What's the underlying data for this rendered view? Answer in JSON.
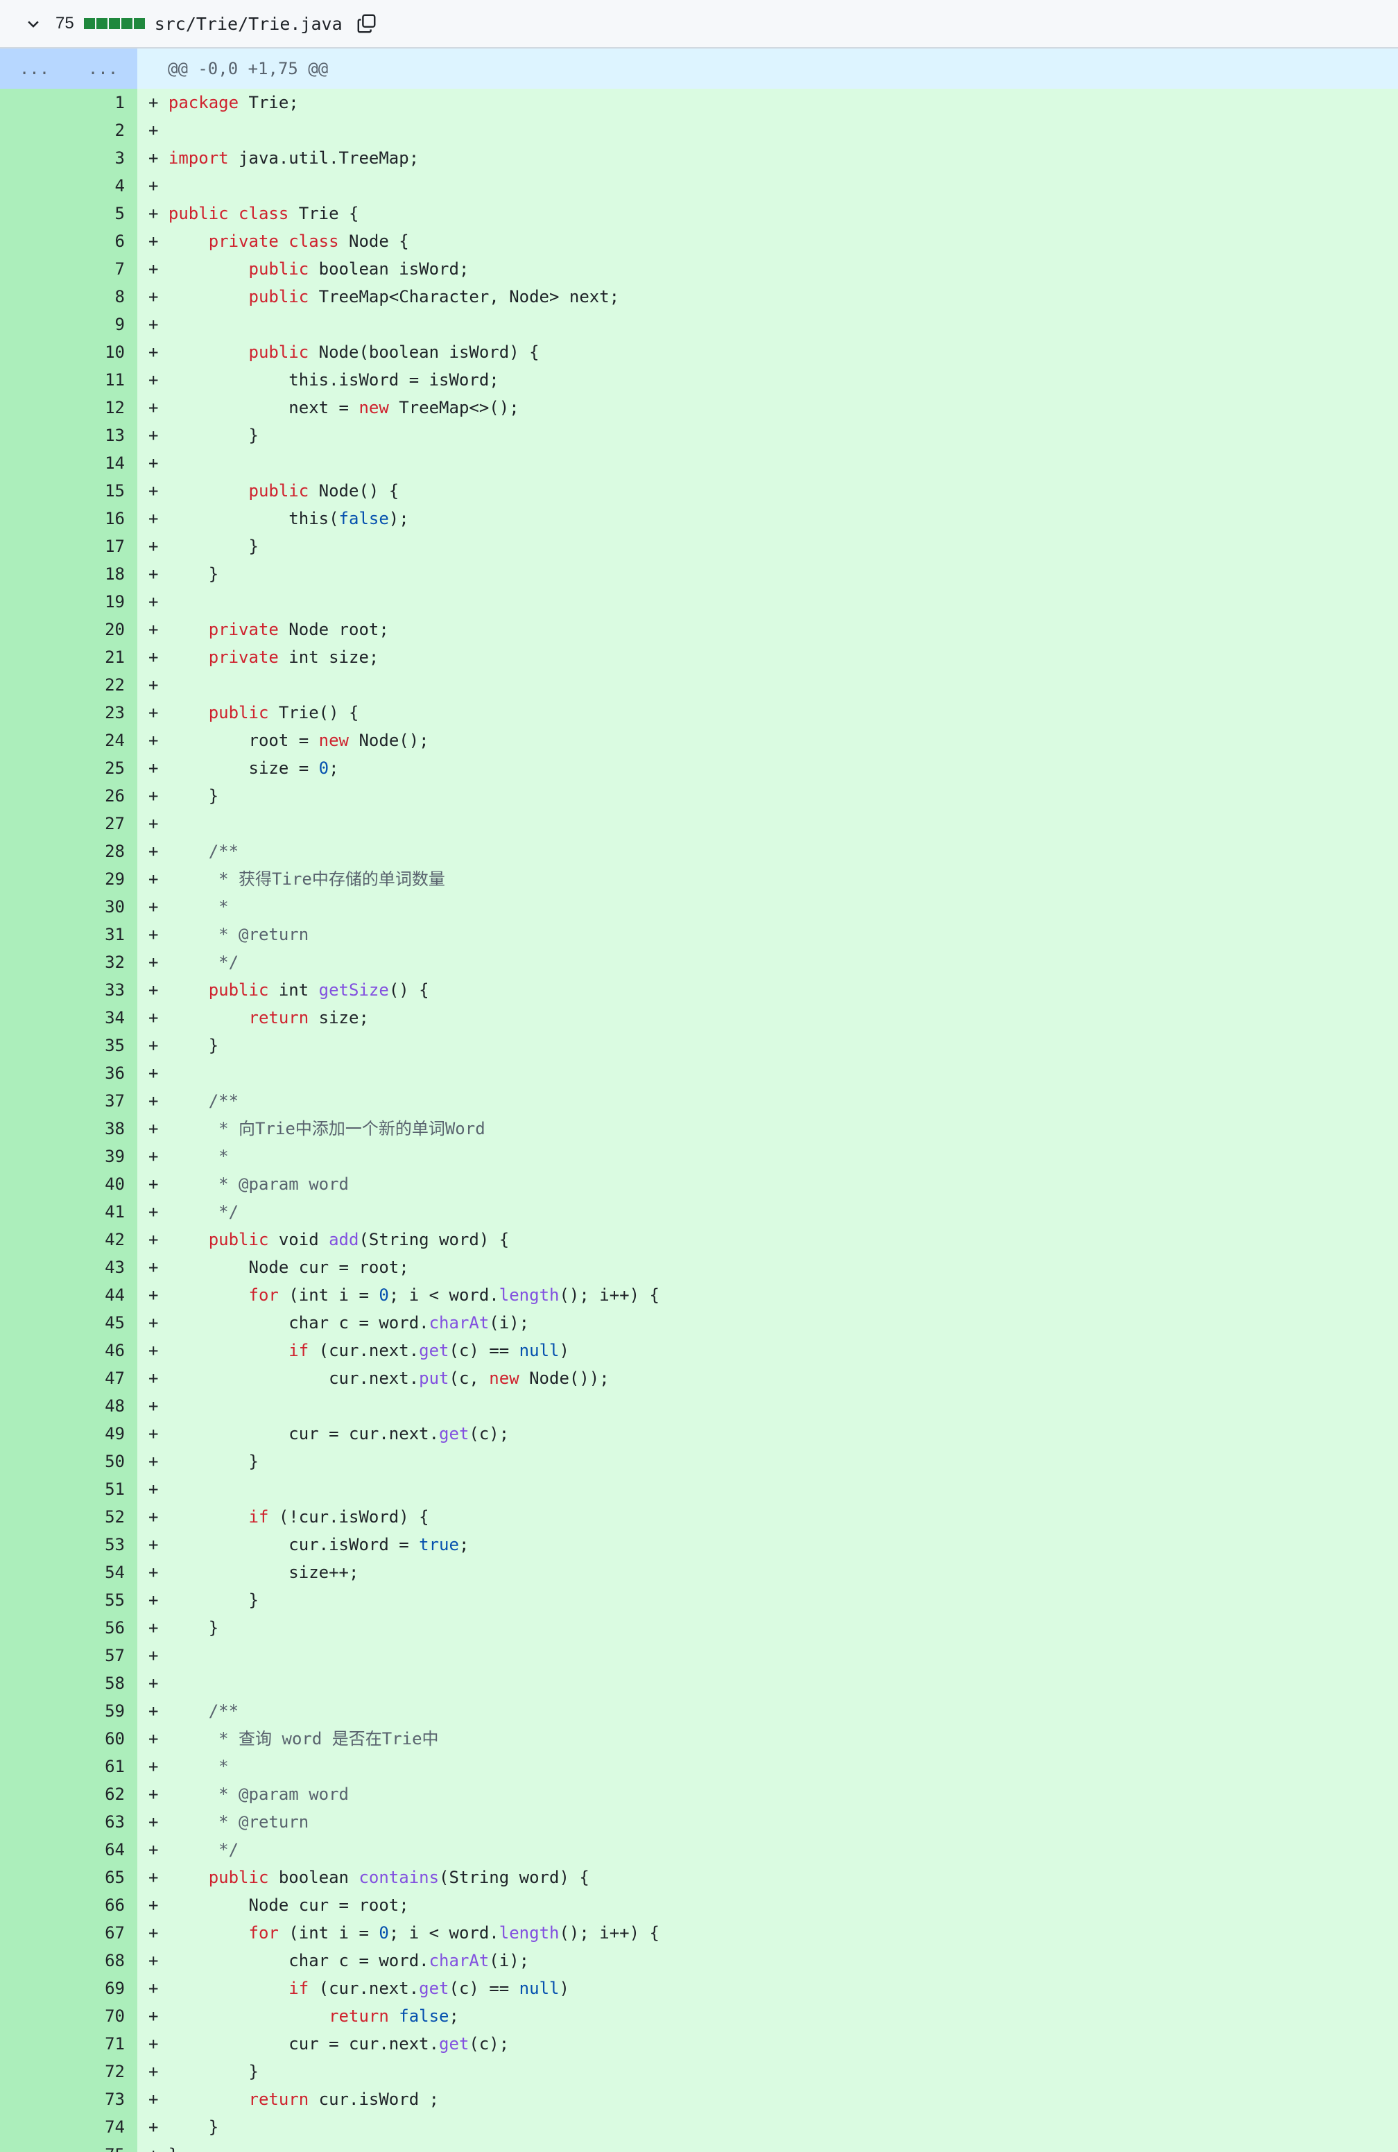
{
  "file_header": {
    "icon_toggle": "chevron-down-icon",
    "changes": "75",
    "path": "src/Trie/Trie.java",
    "icon_copy": "copy-icon"
  },
  "hunk": {
    "old_expand": "...",
    "new_expand": "...",
    "header": "@@ -0,0 +1,75 @@"
  },
  "colors": {
    "addition_gutter": "#aceebb",
    "addition_bg": "#dafbe1",
    "hunk_gutter": "#b7d7ff",
    "hunk_bg": "#ddf4ff",
    "keyword": "#cf222e",
    "function": "#8250df",
    "literal": "#0550ae",
    "comment": "#59636e",
    "diffstat": "#1f883d"
  },
  "lines": [
    {
      "n": "1",
      "code": [
        [
          "kw",
          "package"
        ],
        [
          "t",
          " Trie;"
        ]
      ]
    },
    {
      "n": "2",
      "code": []
    },
    {
      "n": "3",
      "code": [
        [
          "kw",
          "import"
        ],
        [
          "t",
          " java.util.TreeMap;"
        ]
      ]
    },
    {
      "n": "4",
      "code": []
    },
    {
      "n": "5",
      "code": [
        [
          "kw",
          "public class"
        ],
        [
          "t",
          " Trie {"
        ]
      ]
    },
    {
      "n": "6",
      "code": [
        [
          "t",
          "    "
        ],
        [
          "kw",
          "private class"
        ],
        [
          "t",
          " Node {"
        ]
      ]
    },
    {
      "n": "7",
      "code": [
        [
          "t",
          "        "
        ],
        [
          "kw",
          "public"
        ],
        [
          "t",
          " boolean isWord;"
        ]
      ]
    },
    {
      "n": "8",
      "code": [
        [
          "t",
          "        "
        ],
        [
          "kw",
          "public"
        ],
        [
          "t",
          " TreeMap<Character, Node> next;"
        ]
      ]
    },
    {
      "n": "9",
      "code": []
    },
    {
      "n": "10",
      "code": [
        [
          "t",
          "        "
        ],
        [
          "kw",
          "public"
        ],
        [
          "t",
          " Node(boolean isWord) {"
        ]
      ]
    },
    {
      "n": "11",
      "code": [
        [
          "t",
          "            this.isWord = isWord;"
        ]
      ]
    },
    {
      "n": "12",
      "code": [
        [
          "t",
          "            next = "
        ],
        [
          "kw",
          "new"
        ],
        [
          "t",
          " TreeMap<>();"
        ]
      ]
    },
    {
      "n": "13",
      "code": [
        [
          "t",
          "        }"
        ]
      ]
    },
    {
      "n": "14",
      "code": []
    },
    {
      "n": "15",
      "code": [
        [
          "t",
          "        "
        ],
        [
          "kw",
          "public"
        ],
        [
          "t",
          " Node() {"
        ]
      ]
    },
    {
      "n": "16",
      "code": [
        [
          "t",
          "            this("
        ],
        [
          "lit",
          "false"
        ],
        [
          "t",
          ");"
        ]
      ]
    },
    {
      "n": "17",
      "code": [
        [
          "t",
          "        }"
        ]
      ]
    },
    {
      "n": "18",
      "code": [
        [
          "t",
          "    }"
        ]
      ]
    },
    {
      "n": "19",
      "code": []
    },
    {
      "n": "20",
      "code": [
        [
          "t",
          "    "
        ],
        [
          "kw",
          "private"
        ],
        [
          "t",
          " Node root;"
        ]
      ]
    },
    {
      "n": "21",
      "code": [
        [
          "t",
          "    "
        ],
        [
          "kw",
          "private"
        ],
        [
          "t",
          " int size;"
        ]
      ]
    },
    {
      "n": "22",
      "code": []
    },
    {
      "n": "23",
      "code": [
        [
          "t",
          "    "
        ],
        [
          "kw",
          "public"
        ],
        [
          "t",
          " Trie() {"
        ]
      ]
    },
    {
      "n": "24",
      "code": [
        [
          "t",
          "        root = "
        ],
        [
          "kw",
          "new"
        ],
        [
          "t",
          " Node();"
        ]
      ]
    },
    {
      "n": "25",
      "code": [
        [
          "t",
          "        size = "
        ],
        [
          "lit",
          "0"
        ],
        [
          "t",
          ";"
        ]
      ]
    },
    {
      "n": "26",
      "code": [
        [
          "t",
          "    }"
        ]
      ]
    },
    {
      "n": "27",
      "code": []
    },
    {
      "n": "28",
      "code": [
        [
          "t",
          "    "
        ],
        [
          "cm",
          "/**"
        ]
      ]
    },
    {
      "n": "29",
      "code": [
        [
          "t",
          "    "
        ],
        [
          "cm",
          " * 获得Tire中存储的单词数量"
        ]
      ]
    },
    {
      "n": "30",
      "code": [
        [
          "t",
          "    "
        ],
        [
          "cm",
          " *"
        ]
      ]
    },
    {
      "n": "31",
      "code": [
        [
          "t",
          "    "
        ],
        [
          "cm",
          " * @return"
        ]
      ]
    },
    {
      "n": "32",
      "code": [
        [
          "t",
          "    "
        ],
        [
          "cm",
          " */"
        ]
      ]
    },
    {
      "n": "33",
      "code": [
        [
          "t",
          "    "
        ],
        [
          "kw",
          "public"
        ],
        [
          "t",
          " int "
        ],
        [
          "fn",
          "getSize"
        ],
        [
          "t",
          "() {"
        ]
      ]
    },
    {
      "n": "34",
      "code": [
        [
          "t",
          "        "
        ],
        [
          "kw",
          "return"
        ],
        [
          "t",
          " size;"
        ]
      ]
    },
    {
      "n": "35",
      "code": [
        [
          "t",
          "    }"
        ]
      ]
    },
    {
      "n": "36",
      "code": []
    },
    {
      "n": "37",
      "code": [
        [
          "t",
          "    "
        ],
        [
          "cm",
          "/**"
        ]
      ]
    },
    {
      "n": "38",
      "code": [
        [
          "t",
          "    "
        ],
        [
          "cm",
          " * 向Trie中添加一个新的单词Word"
        ]
      ]
    },
    {
      "n": "39",
      "code": [
        [
          "t",
          "    "
        ],
        [
          "cm",
          " *"
        ]
      ]
    },
    {
      "n": "40",
      "code": [
        [
          "t",
          "    "
        ],
        [
          "cm",
          " * @param word"
        ]
      ]
    },
    {
      "n": "41",
      "code": [
        [
          "t",
          "    "
        ],
        [
          "cm",
          " */"
        ]
      ]
    },
    {
      "n": "42",
      "code": [
        [
          "t",
          "    "
        ],
        [
          "kw",
          "public"
        ],
        [
          "t",
          " void "
        ],
        [
          "fn",
          "add"
        ],
        [
          "t",
          "(String word) {"
        ]
      ]
    },
    {
      "n": "43",
      "code": [
        [
          "t",
          "        Node cur = root;"
        ]
      ]
    },
    {
      "n": "44",
      "code": [
        [
          "t",
          "        "
        ],
        [
          "kw",
          "for"
        ],
        [
          "t",
          " (int i = "
        ],
        [
          "lit",
          "0"
        ],
        [
          "t",
          "; i < word."
        ],
        [
          "fn",
          "length"
        ],
        [
          "t",
          "(); i++) {"
        ]
      ]
    },
    {
      "n": "45",
      "code": [
        [
          "t",
          "            char c = word."
        ],
        [
          "fn",
          "charAt"
        ],
        [
          "t",
          "(i);"
        ]
      ]
    },
    {
      "n": "46",
      "code": [
        [
          "t",
          "            "
        ],
        [
          "kw",
          "if"
        ],
        [
          "t",
          " (cur.next."
        ],
        [
          "fn",
          "get"
        ],
        [
          "t",
          "(c) == "
        ],
        [
          "lit",
          "null"
        ],
        [
          "t",
          ")"
        ]
      ]
    },
    {
      "n": "47",
      "code": [
        [
          "t",
          "                cur.next."
        ],
        [
          "fn",
          "put"
        ],
        [
          "t",
          "(c, "
        ],
        [
          "kw",
          "new"
        ],
        [
          "t",
          " Node());"
        ]
      ]
    },
    {
      "n": "48",
      "code": []
    },
    {
      "n": "49",
      "code": [
        [
          "t",
          "            cur = cur.next."
        ],
        [
          "fn",
          "get"
        ],
        [
          "t",
          "(c);"
        ]
      ]
    },
    {
      "n": "50",
      "code": [
        [
          "t",
          "        }"
        ]
      ]
    },
    {
      "n": "51",
      "code": []
    },
    {
      "n": "52",
      "code": [
        [
          "t",
          "        "
        ],
        [
          "kw",
          "if"
        ],
        [
          "t",
          " (!cur.isWord) {"
        ]
      ]
    },
    {
      "n": "53",
      "code": [
        [
          "t",
          "            cur.isWord = "
        ],
        [
          "lit",
          "true"
        ],
        [
          "t",
          ";"
        ]
      ]
    },
    {
      "n": "54",
      "code": [
        [
          "t",
          "            size++;"
        ]
      ]
    },
    {
      "n": "55",
      "code": [
        [
          "t",
          "        }"
        ]
      ]
    },
    {
      "n": "56",
      "code": [
        [
          "t",
          "    }"
        ]
      ]
    },
    {
      "n": "57",
      "code": []
    },
    {
      "n": "58",
      "code": []
    },
    {
      "n": "59",
      "code": [
        [
          "t",
          "    "
        ],
        [
          "cm",
          "/**"
        ]
      ]
    },
    {
      "n": "60",
      "code": [
        [
          "t",
          "    "
        ],
        [
          "cm",
          " * 查询 word 是否在Trie中"
        ]
      ]
    },
    {
      "n": "61",
      "code": [
        [
          "t",
          "    "
        ],
        [
          "cm",
          " *"
        ]
      ]
    },
    {
      "n": "62",
      "code": [
        [
          "t",
          "    "
        ],
        [
          "cm",
          " * @param word"
        ]
      ]
    },
    {
      "n": "63",
      "code": [
        [
          "t",
          "    "
        ],
        [
          "cm",
          " * @return"
        ]
      ]
    },
    {
      "n": "64",
      "code": [
        [
          "t",
          "    "
        ],
        [
          "cm",
          " */"
        ]
      ]
    },
    {
      "n": "65",
      "code": [
        [
          "t",
          "    "
        ],
        [
          "kw",
          "public"
        ],
        [
          "t",
          " boolean "
        ],
        [
          "fn",
          "contains"
        ],
        [
          "t",
          "(String word) {"
        ]
      ]
    },
    {
      "n": "66",
      "code": [
        [
          "t",
          "        Node cur = root;"
        ]
      ]
    },
    {
      "n": "67",
      "code": [
        [
          "t",
          "        "
        ],
        [
          "kw",
          "for"
        ],
        [
          "t",
          " (int i = "
        ],
        [
          "lit",
          "0"
        ],
        [
          "t",
          "; i < word."
        ],
        [
          "fn",
          "length"
        ],
        [
          "t",
          "(); i++) {"
        ]
      ]
    },
    {
      "n": "68",
      "code": [
        [
          "t",
          "            char c = word."
        ],
        [
          "fn",
          "charAt"
        ],
        [
          "t",
          "(i);"
        ]
      ]
    },
    {
      "n": "69",
      "code": [
        [
          "t",
          "            "
        ],
        [
          "kw",
          "if"
        ],
        [
          "t",
          " (cur.next."
        ],
        [
          "fn",
          "get"
        ],
        [
          "t",
          "(c) == "
        ],
        [
          "lit",
          "null"
        ],
        [
          "t",
          ")"
        ]
      ]
    },
    {
      "n": "70",
      "code": [
        [
          "t",
          "                "
        ],
        [
          "kw",
          "return"
        ],
        [
          "t",
          " "
        ],
        [
          "lit",
          "false"
        ],
        [
          "t",
          ";"
        ]
      ]
    },
    {
      "n": "71",
      "code": [
        [
          "t",
          "            cur = cur.next."
        ],
        [
          "fn",
          "get"
        ],
        [
          "t",
          "(c);"
        ]
      ]
    },
    {
      "n": "72",
      "code": [
        [
          "t",
          "        }"
        ]
      ]
    },
    {
      "n": "73",
      "code": [
        [
          "t",
          "        "
        ],
        [
          "kw",
          "return"
        ],
        [
          "t",
          " cur.isWord ;"
        ]
      ]
    },
    {
      "n": "74",
      "code": [
        [
          "t",
          "    }"
        ]
      ]
    },
    {
      "n": "75",
      "code": [
        [
          "t",
          "}"
        ]
      ]
    }
  ]
}
